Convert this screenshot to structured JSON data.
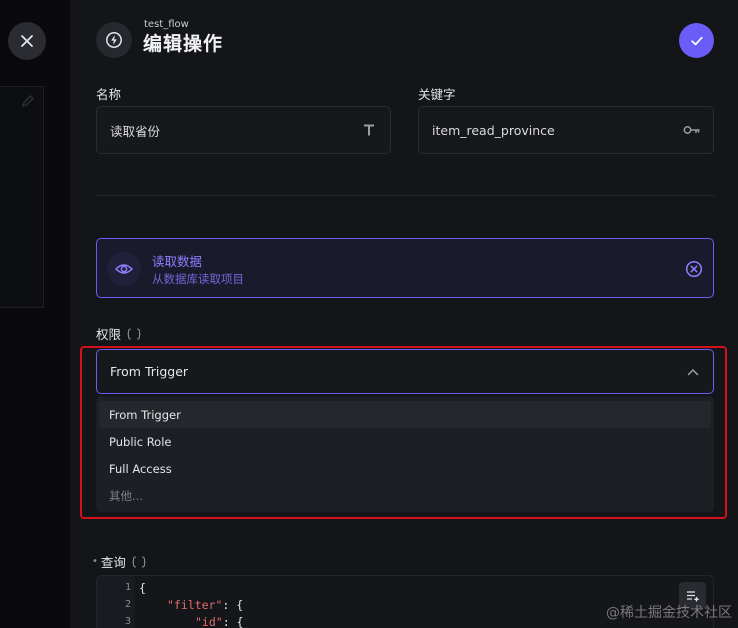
{
  "header": {
    "subtitle": "test_flow",
    "title": "编辑操作"
  },
  "form": {
    "name_label": "名称",
    "name_value": "读取省份",
    "key_label": "关键字",
    "key_value": "item_read_province"
  },
  "action": {
    "title": "读取数据",
    "description": "从数据库读取项目"
  },
  "permissions": {
    "label": "权限",
    "selected": "From Trigger",
    "options": [
      "From Trigger",
      "Public Role",
      "Full Access",
      "其他..."
    ]
  },
  "query": {
    "label": "查询",
    "lines": [
      {
        "num": "1",
        "text": "{"
      },
      {
        "num": "2",
        "key": "\"filter\"",
        "rest": ": {"
      },
      {
        "num": "3",
        "key": "\"id\"",
        "rest": ": {"
      }
    ]
  },
  "watermark": "@稀土掘金技术社区",
  "colors": {
    "accent": "#6a5cf6",
    "highlight": "#d4101a",
    "string": "#e36b6b"
  },
  "icons": {
    "close": "close-icon",
    "bolt": "bolt-icon",
    "check": "check-icon",
    "text": "text-type-icon",
    "key": "key-icon",
    "eye": "eye-icon",
    "remove": "circle-x-icon",
    "chevron": "chevron-up-icon",
    "format": "format-list-icon"
  }
}
